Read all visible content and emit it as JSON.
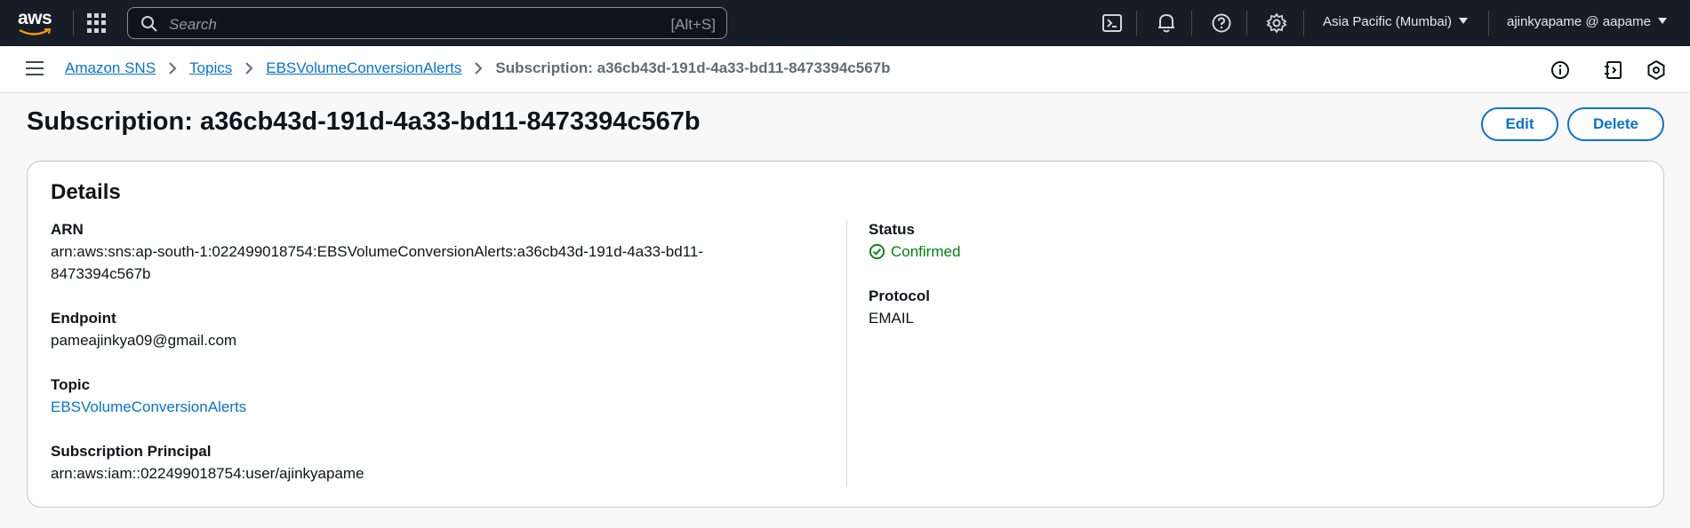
{
  "topnav": {
    "logo_text": "aws",
    "search_placeholder": "Search",
    "search_shortcut": "[Alt+S]",
    "region": "Asia Pacific (Mumbai)",
    "user": "ajinkyapame @ aapame"
  },
  "breadcrumb": {
    "items": [
      "Amazon SNS",
      "Topics",
      "EBSVolumeConversionAlerts"
    ],
    "current": "Subscription: a36cb43d-191d-4a33-bd11-8473394c567b"
  },
  "page": {
    "title": "Subscription: a36cb43d-191d-4a33-bd11-8473394c567b",
    "edit_label": "Edit",
    "delete_label": "Delete"
  },
  "details": {
    "title": "Details",
    "arn_label": "ARN",
    "arn_line1": "arn:aws:sns:ap-south-1:022499018754:EBSVolumeConversionAlerts:a36cb43d-191d-4a33-bd11-",
    "arn_line2": "8473394c567b",
    "endpoint_label": "Endpoint",
    "endpoint_value": "pameajinkya09@gmail.com",
    "topic_label": "Topic",
    "topic_value": "EBSVolumeConversionAlerts",
    "principal_label": "Subscription Principal",
    "principal_value": "arn:aws:iam::022499018754:user/ajinkyapame",
    "status_label": "Status",
    "status_value": "Confirmed",
    "protocol_label": "Protocol",
    "protocol_value": "EMAIL"
  },
  "colors": {
    "accent": "#0972d3",
    "nav_bg": "#161d26",
    "success": "#037f0c"
  }
}
